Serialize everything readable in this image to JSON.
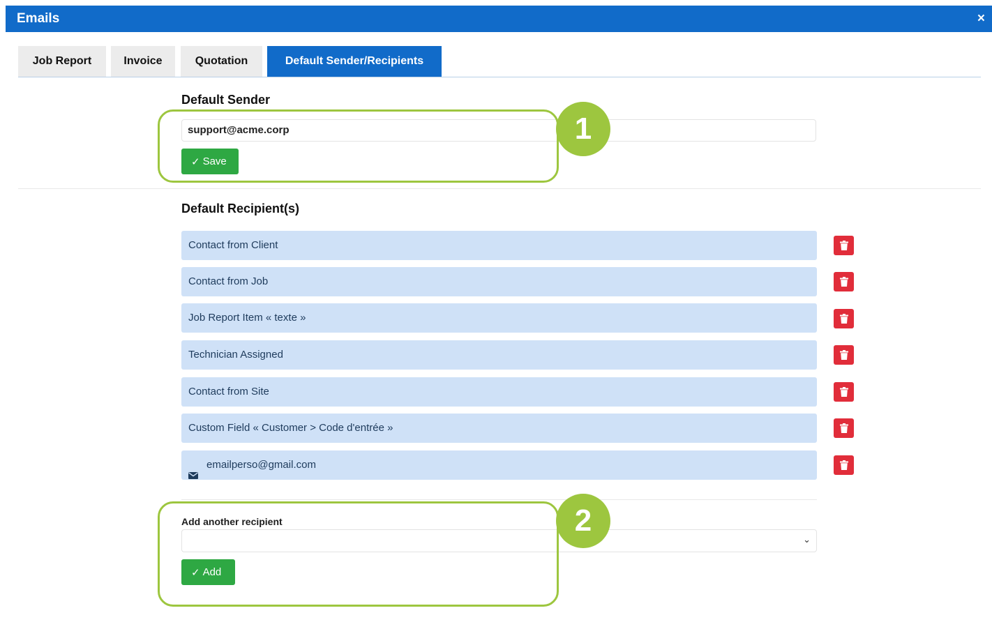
{
  "window": {
    "title": "Emails",
    "close_glyph": "×"
  },
  "tabs": [
    {
      "label": "Job Report",
      "active": false
    },
    {
      "label": "Invoice",
      "active": false
    },
    {
      "label": "Quotation",
      "active": false
    },
    {
      "label": "Default Sender/Recipients",
      "active": true
    }
  ],
  "sender": {
    "title": "Default Sender",
    "value": "support@acme.corp",
    "save_label": "Save"
  },
  "recipients": {
    "title": "Default Recipient(s)",
    "items": [
      {
        "label": "Contact from Client"
      },
      {
        "label": "Contact from Job"
      },
      {
        "label": "Job Report Item « texte »"
      },
      {
        "label": "Technician Assigned"
      },
      {
        "label": "Contact from Site"
      },
      {
        "label": "Custom Field « Customer > Code d'entrée »"
      },
      {
        "label": "emailperso@gmail.com",
        "icon": "envelope-icon"
      }
    ]
  },
  "add_recipient": {
    "label": "Add another recipient",
    "selected": "",
    "add_label": "Add"
  },
  "callouts": [
    "1",
    "2"
  ],
  "colors": {
    "header": "#116bc9",
    "success": "#2ea843",
    "danger": "#e12d3a",
    "recipient_bg": "#cfe1f7",
    "callout": "#9dc63f"
  }
}
